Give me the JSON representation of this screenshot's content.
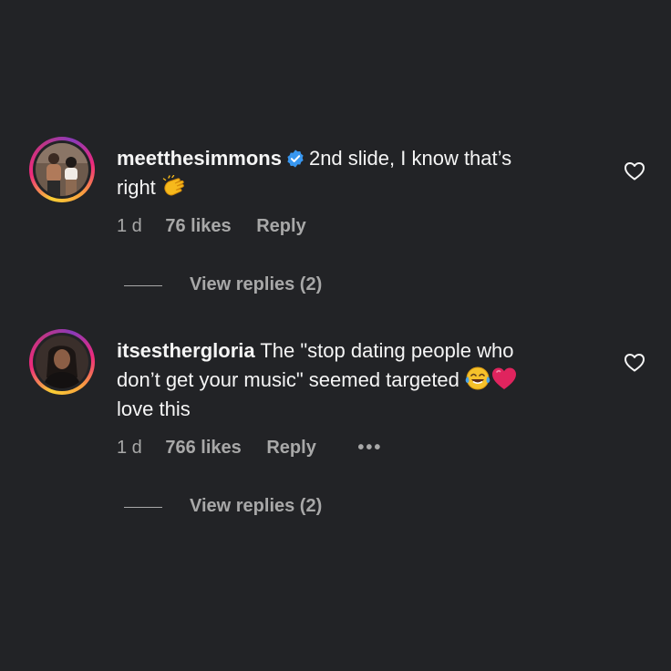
{
  "comments": [
    {
      "username": "meetthesimmons",
      "verified": true,
      "text_line1": "2nd slide, I know that’s",
      "text_line2": "right",
      "emojis": [
        "clapping-hands"
      ],
      "time": "1 d",
      "likes": "76 likes",
      "reply_label": "Reply",
      "view_replies": "View replies (2)"
    },
    {
      "username": "itsesthergloria",
      "verified": false,
      "text_line1": "The \"stop dating people who",
      "text_line2": "don’t get your music\" seemed targeted",
      "text_line3": "love this",
      "emojis": [
        "face-with-tears-of-joy",
        "red-heart"
      ],
      "time": "1 d",
      "likes": "766 likes",
      "reply_label": "Reply",
      "more": "•••",
      "view_replies": "View replies (2)"
    }
  ],
  "colors": {
    "background": "#222326",
    "text": "#f5f5f5",
    "secondary": "#a8a8a8",
    "verified": "#3897f0",
    "heart_emoji": "#e0245e"
  }
}
